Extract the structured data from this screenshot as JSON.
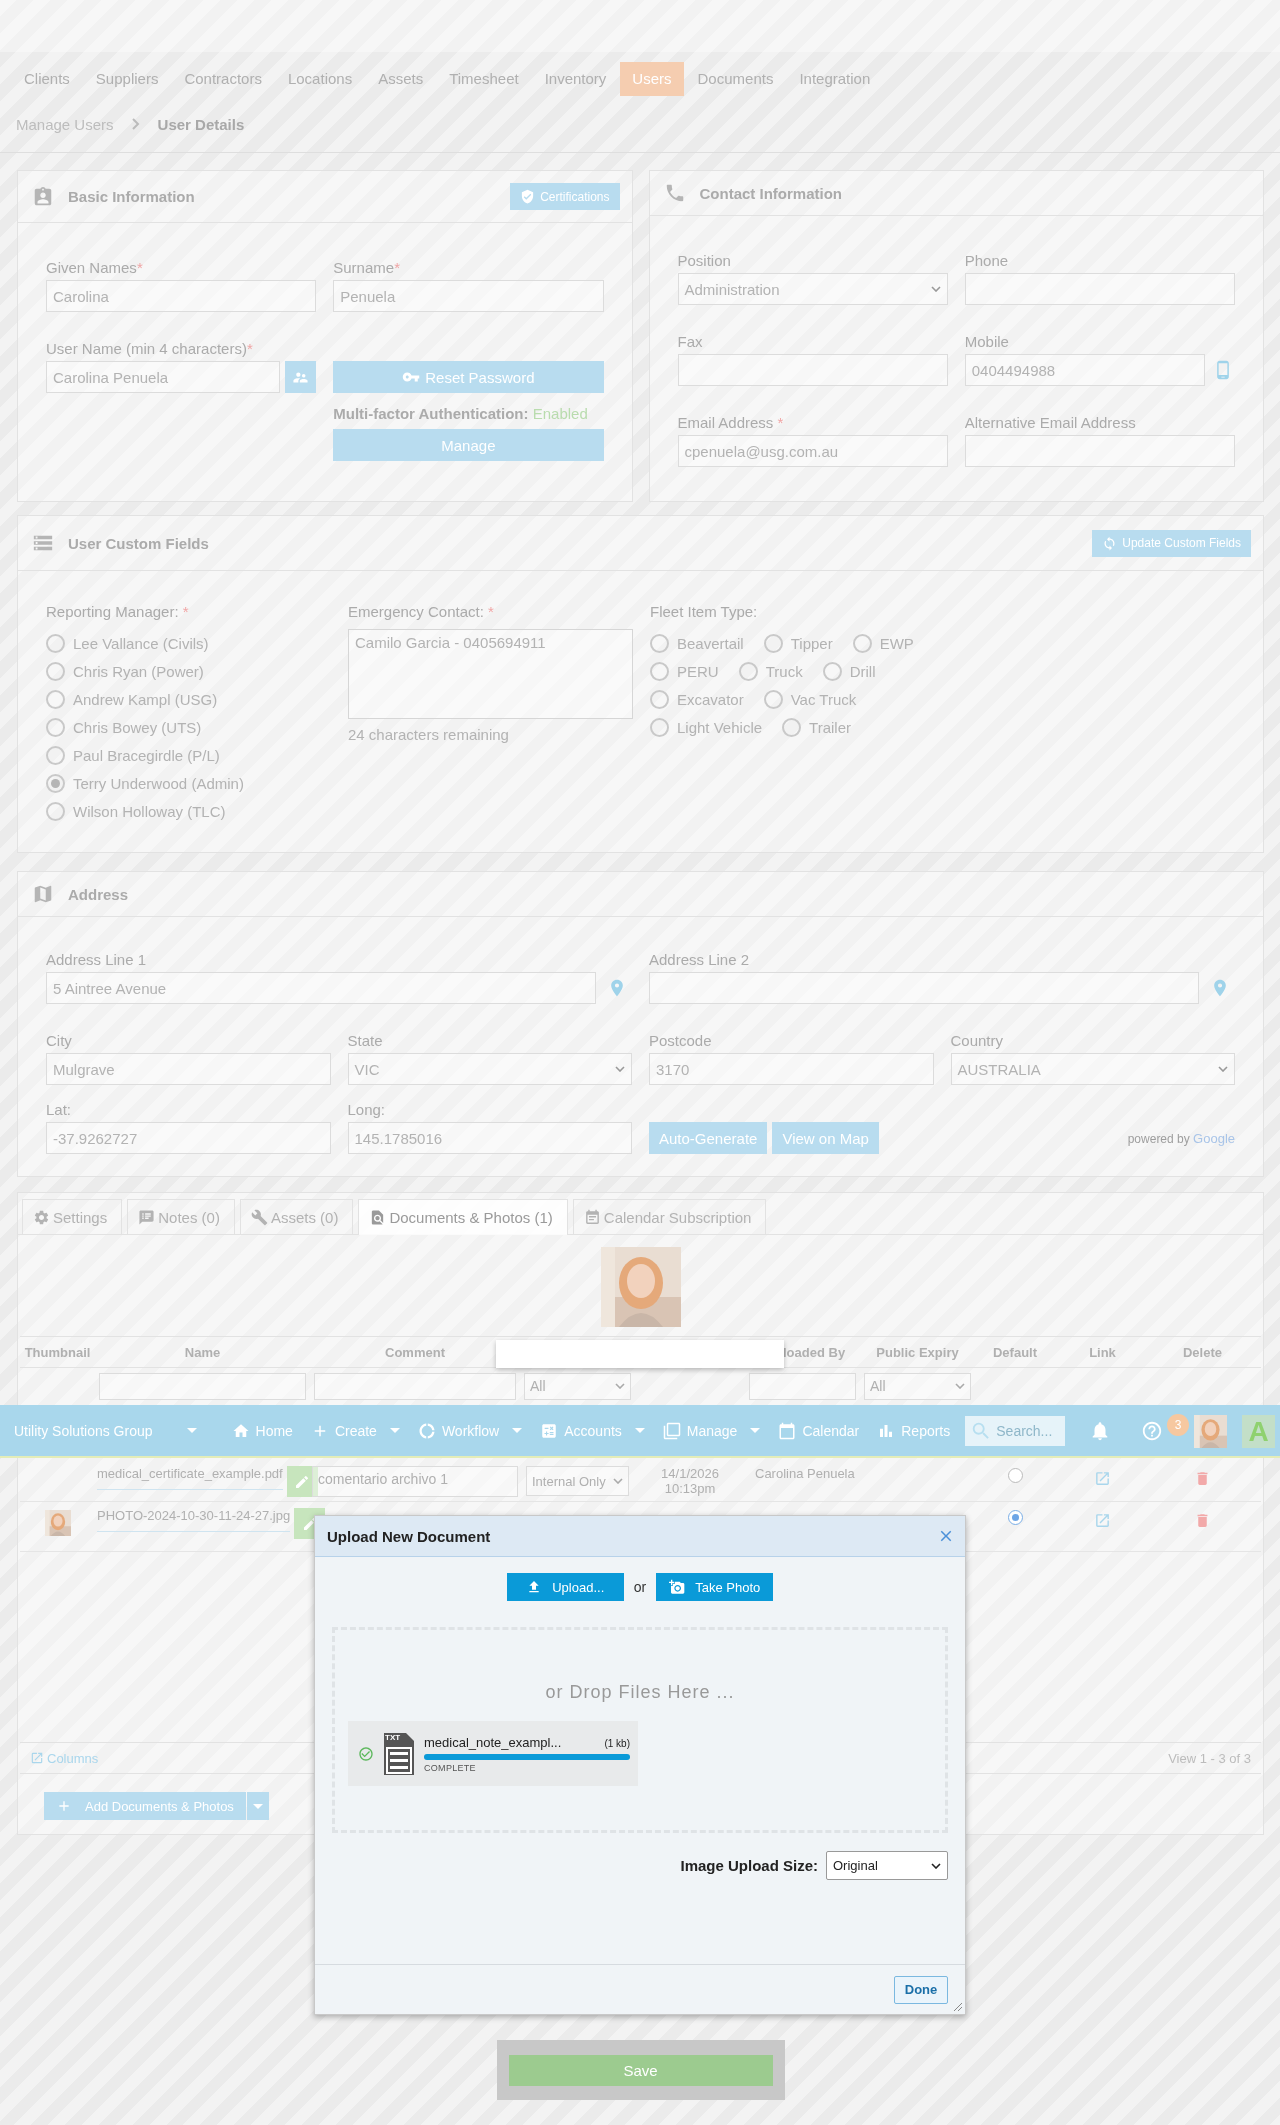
{
  "header_tabs": [
    {
      "label": "Clients",
      "selected": false
    },
    {
      "label": "Suppliers",
      "selected": false
    },
    {
      "label": "Contractors",
      "selected": false
    },
    {
      "label": "Locations",
      "selected": false
    },
    {
      "label": "Assets",
      "selected": false
    },
    {
      "label": "Timesheet",
      "selected": false
    },
    {
      "label": "Inventory",
      "selected": false
    },
    {
      "label": "Users",
      "selected": true
    },
    {
      "label": "Documents",
      "selected": false
    },
    {
      "label": "Integration",
      "selected": false
    }
  ],
  "breadcrumb": {
    "parent": "Manage Users",
    "current": "User Details"
  },
  "basic_information": {
    "title": "Basic Information",
    "certifications_button": "Certifications",
    "given_names": {
      "label": "Given Names",
      "required_mark": "*",
      "value": "Carolina"
    },
    "surname": {
      "label": "Surname",
      "required_mark": "*",
      "value": "Penuela"
    },
    "user_name": {
      "label": "User Name (min 4 characters)",
      "required_mark": "*",
      "value": "Carolina Penuela"
    },
    "reset_password_button": "Reset Password",
    "mfa": {
      "label": "Multi-factor Authentication:",
      "status": "Enabled"
    },
    "manage_button": "Manage"
  },
  "contact_information": {
    "title": "Contact Information",
    "fields": [
      {
        "kind": "select",
        "label": "Position",
        "value": "Administration"
      },
      {
        "kind": "text",
        "label": "Phone"
      },
      {
        "kind": "text",
        "label": "Fax"
      },
      {
        "kind": "phone",
        "label": "Mobile",
        "value": "0404494988"
      },
      {
        "kind": "text",
        "label": "Email Address",
        "required_mark": "*",
        "value": "cpenuela@usg.com.au"
      },
      {
        "kind": "text",
        "label": "Alternative Email Address"
      }
    ]
  },
  "user_custom_fields": {
    "title": "User Custom Fields",
    "update_button": "Update Custom Fields",
    "reporting_manager": {
      "label": "Reporting Manager:",
      "required_mark": "*",
      "options": [
        {
          "label": "Lee Vallance (Civils)",
          "selected": false
        },
        {
          "label": "Chris Ryan (Power)",
          "selected": false
        },
        {
          "label": "Andrew Kampl (USG)",
          "selected": false
        },
        {
          "label": "Chris Bowey (UTS)",
          "selected": false
        },
        {
          "label": "Paul Bracegirdle (P/L)",
          "selected": false
        },
        {
          "label": "Terry Underwood (Admin)",
          "selected": true
        },
        {
          "label": "Wilson Holloway (TLC)",
          "selected": false
        }
      ]
    },
    "emergency_contact": {
      "label": "Emergency Contact:",
      "required_mark": "*",
      "value": "Camilo Garcia - 0405694911",
      "remaining": "24 characters remaining"
    },
    "fleet_item_type": {
      "label": "Fleet Item Type:",
      "rows": [
        [
          {
            "label": "Beavertail",
            "selected": false
          },
          {
            "label": "Tipper",
            "selected": false
          },
          {
            "label": "EWP",
            "selected": false
          }
        ],
        [
          {
            "label": "PERU",
            "selected": false
          },
          {
            "label": "Truck",
            "selected": false
          },
          {
            "label": "Drill",
            "selected": false
          }
        ],
        [
          {
            "label": "Excavator",
            "selected": false
          },
          {
            "label": "Vac Truck",
            "selected": false
          }
        ],
        [
          {
            "label": "Light Vehicle",
            "selected": false
          },
          {
            "label": "Trailer",
            "selected": false
          }
        ]
      ]
    }
  },
  "address": {
    "title": "Address",
    "address_lines": [
      {
        "kind": "location",
        "label": "Address Line 1",
        "value": "5 Aintree Avenue"
      },
      {
        "kind": "location",
        "label": "Address Line 2"
      }
    ],
    "locality": [
      {
        "kind": "text",
        "label": "City",
        "value": "Mulgrave"
      },
      {
        "kind": "select",
        "label": "State",
        "value": "VIC"
      },
      {
        "kind": "text",
        "label": "Postcode",
        "value": "3170"
      },
      {
        "kind": "select",
        "label": "Country",
        "value": "AUSTRALIA"
      }
    ],
    "coordinates": [
      {
        "label": "Lat:",
        "value": "-37.9262727"
      },
      {
        "label": "Long:",
        "value": "145.1785016"
      }
    ],
    "buttons": [
      "Auto-Generate",
      "View on Map"
    ],
    "attribution": {
      "prefix": "powered by",
      "brand": "Google"
    }
  },
  "detail_tabs": [
    {
      "kind": "settings",
      "label": "Settings",
      "selected": false
    },
    {
      "kind": "notes",
      "label": "Notes (0)",
      "selected": false
    },
    {
      "kind": "assets",
      "label": "Assets (0)",
      "selected": false
    },
    {
      "kind": "documents",
      "label": "Documents & Photos (1)",
      "selected": true
    },
    {
      "kind": "calendar",
      "label": "Calendar Subscription",
      "selected": false
    }
  ],
  "documents_table": {
    "columns": [
      "Thumbnail",
      "Name",
      "Comment",
      "loaded By",
      "Public Expiry",
      "Default",
      "Link",
      "Delete"
    ],
    "filters": [
      {
        "kind": "text"
      },
      {
        "kind": "text"
      },
      {
        "kind": "select",
        "value": "All"
      },
      {
        "kind": "text"
      },
      {
        "kind": "select",
        "value": "All"
      }
    ],
    "rows": [
      {
        "has_thumbnail": false,
        "name": "medical_certificate_example.pdf",
        "comment": "comentario archivo 1",
        "visibility": "Internal Only",
        "date": "14/1/2026",
        "time": "10:13pm",
        "uploaded_by": "Carolina Penuela",
        "default": false
      },
      {
        "has_thumbnail": true,
        "name": "PHOTO-2024-10-30-11-24-27.jpg",
        "default": true
      }
    ],
    "columns_link": "Columns",
    "pager": "View 1 - 3 of 3",
    "add_button": "Add Documents & Photos"
  },
  "nav_bar": {
    "org": "Utility Solutions Group",
    "items": [
      {
        "kind": "home",
        "label": "Home",
        "dropdown": false
      },
      {
        "kind": "create",
        "label": "Create",
        "dropdown": true
      },
      {
        "kind": "workflow",
        "label": "Workflow",
        "dropdown": true
      },
      {
        "kind": "accounts",
        "label": "Accounts",
        "dropdown": true
      },
      {
        "kind": "manage",
        "label": "Manage",
        "dropdown": true
      },
      {
        "kind": "calendar",
        "label": "Calendar",
        "dropdown": false
      },
      {
        "kind": "reports",
        "label": "Reports",
        "dropdown": false
      }
    ],
    "search_placeholder": "Search...",
    "notification_count": "3",
    "logo_letter": "A"
  },
  "upload_dialog": {
    "title": "Upload New Document",
    "upload_button": "Upload...",
    "separator": "or",
    "photo_button": "Take Photo",
    "drop_hint": "or Drop Files Here ...",
    "files": [
      {
        "type_label": "TXT",
        "name": "medical_note_exampl...",
        "size": "(1 kb)",
        "level": 1,
        "status": "COMPLETE",
        "complete": true
      }
    ],
    "size_label": "Image Upload Size:",
    "size_value": "Original",
    "done_button": "Done"
  },
  "save_button": "Save"
}
